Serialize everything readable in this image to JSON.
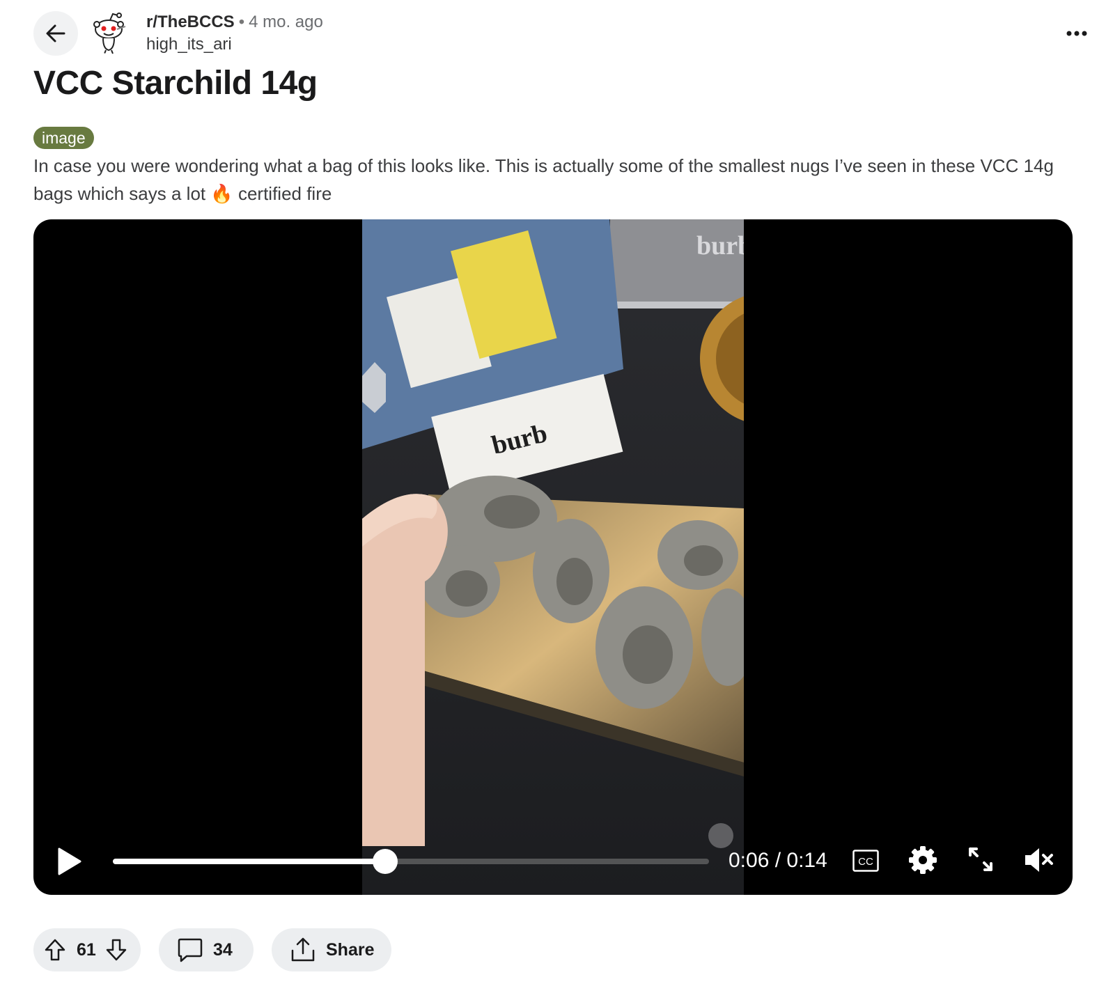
{
  "post": {
    "subreddit": "r/TheBCCS",
    "separator": "•",
    "age": "4 mo. ago",
    "author": "high_its_ari",
    "title": "VCC Starchild 14g",
    "flair": "image",
    "body": "In case you were wondering what a bag of this looks like. This is actually some of the smallest nugs I’ve seen in these VCC 14g bags which says a lot 🔥 certified fire"
  },
  "video": {
    "current_time": "0:06",
    "duration": "0:14",
    "progress": 0.4571,
    "cc_label": "CC",
    "muted": true,
    "frame_text": {
      "bag_brand": "burb",
      "box_brand": "burb"
    }
  },
  "actions": {
    "upvotes": "61",
    "comments": "34",
    "share_label": "Share"
  },
  "icons": {
    "back": "arrow-left-icon",
    "more": "more-horizontal-icon",
    "play": "play-icon",
    "cc": "closed-captions-icon",
    "settings": "gear-icon",
    "fullscreen": "expand-icon",
    "mute": "volume-muted-icon",
    "upvote": "upvote-arrow-icon",
    "downvote": "downvote-arrow-icon",
    "comment": "comment-bubble-icon",
    "share": "share-icon"
  },
  "colors": {
    "flair_bg": "#687a40",
    "pill_bg": "#eceef0",
    "video_bg": "#000000"
  }
}
